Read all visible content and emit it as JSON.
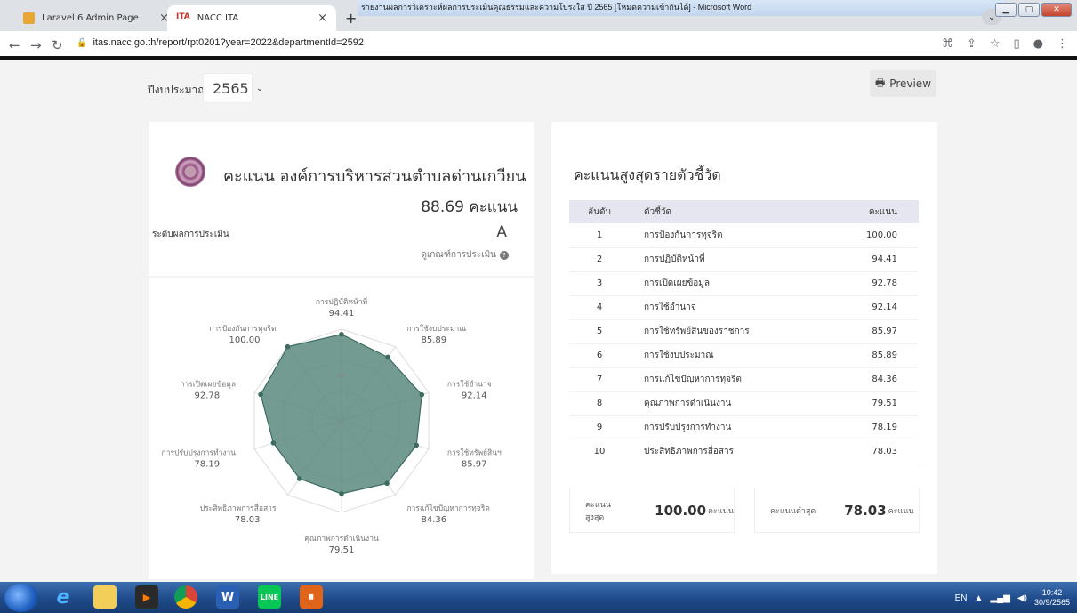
{
  "browser": {
    "tabs": [
      {
        "label": "Laravel 6 Admin Page"
      },
      {
        "label": "NACC ITA",
        "favicon_text": "ITA"
      }
    ],
    "overlay_window_title": "รายงานผลการวิเคราะห์ผลการประเมินคุณธรรมและความโปร่งใส ปี 2565 [โหมดความเข้ากันได้] - Microsoft Word",
    "url": "itas.nacc.go.th/report/rpt0201?year=2022&departmentId=2592"
  },
  "page": {
    "budget_year_label": "ปีงบประมาณ",
    "budget_year": "2565",
    "preview_label": "Preview",
    "org_title": "คะแนน องค์การบริหารส่วนตำบลด่านเกวียน",
    "total_score": "88.69 คะแนน",
    "level_label": "ระดับผลการประเมิน",
    "level_value": "A",
    "criteria_link": "ดูเกณฑ์การประเมิน",
    "radar": {
      "axes": [
        {
          "label": "การปฏิบัติหน้าที่",
          "value": "94.41"
        },
        {
          "label": "การใช้งบประมาณ",
          "value": "85.89"
        },
        {
          "label": "การใช้อำนาจ",
          "value": "92.14"
        },
        {
          "label": "การใช้ทรัพย์สินฯ",
          "value": "85.97"
        },
        {
          "label": "การแก้ไขปัญหาการทุจริต",
          "value": "84.36"
        },
        {
          "label": "คุณภาพการดำเนินงาน",
          "value": "79.51"
        },
        {
          "label": "ประสิทธิภาพการสื่อสาร",
          "value": "78.03"
        },
        {
          "label": "การปรับปรุงการทำงาน",
          "value": "78.19"
        },
        {
          "label": "การเปิดเผยข้อมูล",
          "value": "92.78"
        },
        {
          "label": "การป้องกันการทุจริต",
          "value": "100.00"
        }
      ],
      "ring_labels": [
        "50",
        "0"
      ],
      "fill_color": "#5a8a7e"
    },
    "ranking": {
      "title": "คะแนนสูงสุดรายตัวชี้วัด",
      "headers": {
        "rank": "อันดับ",
        "indicator": "ตัวชี้วัด",
        "score": "คะแนน"
      },
      "rows": [
        {
          "rank": "1",
          "indicator": "การป้องกันการทุจริต",
          "score": "100.00"
        },
        {
          "rank": "2",
          "indicator": "การปฏิบัติหน้าที่",
          "score": "94.41"
        },
        {
          "rank": "3",
          "indicator": "การเปิดเผยข้อมูล",
          "score": "92.78"
        },
        {
          "rank": "4",
          "indicator": "การใช้อำนาจ",
          "score": "92.14"
        },
        {
          "rank": "5",
          "indicator": "การใช้ทรัพย์สินของราชการ",
          "score": "85.97"
        },
        {
          "rank": "6",
          "indicator": "การใช้งบประมาณ",
          "score": "85.89"
        },
        {
          "rank": "7",
          "indicator": "การแก้ไขปัญหาการทุจริต",
          "score": "84.36"
        },
        {
          "rank": "8",
          "indicator": "คุณภาพการดำเนินงาน",
          "score": "79.51"
        },
        {
          "rank": "9",
          "indicator": "การปรับปรุงการทำงาน",
          "score": "78.19"
        },
        {
          "rank": "10",
          "indicator": "ประสิทธิภาพการสื่อสาร",
          "score": "78.03"
        }
      ],
      "max_label": "คะแนนสูงสุด",
      "max_value": "100.00",
      "min_label": "คะแนนต่ำสุด",
      "min_value": "78.03",
      "unit": "คะแนน"
    }
  },
  "taskbar": {
    "lang": "EN",
    "time": "10:42",
    "date": "30/9/2565"
  }
}
